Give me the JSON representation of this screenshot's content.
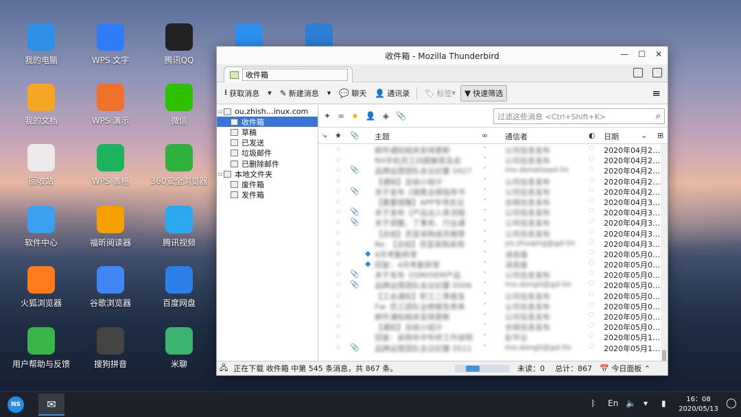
{
  "desktop": {
    "icons": [
      {
        "label": "我的电脑",
        "icon": "computer-icon",
        "color": "#2d8fe6"
      },
      {
        "label": "WPS 文字",
        "icon": "wps-writer-icon",
        "color": "#2f7cf6"
      },
      {
        "label": "腾讯QQ",
        "icon": "qq-icon",
        "color": "#222222"
      },
      {
        "label": "",
        "icon": "feather-app-icon",
        "color": "#2c8ff0"
      },
      {
        "label": "",
        "icon": "monitor-app-icon",
        "color": "#2b7fd6"
      },
      {
        "label": "我的文档",
        "icon": "folder-icon",
        "color": "#f5a623"
      },
      {
        "label": "WPS 演示",
        "icon": "wps-presentation-icon",
        "color": "#f0712c"
      },
      {
        "label": "微信",
        "icon": "wechat-icon",
        "color": "#2dc100"
      },
      {
        "label": "回收站",
        "icon": "recycle-bin-icon",
        "color": "#eaeaea"
      },
      {
        "label": "WPS 表格",
        "icon": "wps-spreadsheet-icon",
        "color": "#1bb35c"
      },
      {
        "label": "360安全浏览器",
        "icon": "browser-360-icon",
        "color": "#30b03c"
      },
      {
        "label": "软件中心",
        "icon": "software-center-icon",
        "color": "#3ca0f0"
      },
      {
        "label": "福昕阅读器",
        "icon": "foxit-reader-icon",
        "color": "#f5a000"
      },
      {
        "label": "腾讯视频",
        "icon": "tencent-video-icon",
        "color": "#2aa8f0"
      },
      {
        "label": "火狐浏览器",
        "icon": "firefox-icon",
        "color": "#ff7b1c"
      },
      {
        "label": "谷歌浏览器",
        "icon": "chrome-icon",
        "color": "#4285f4"
      },
      {
        "label": "百度网盘",
        "icon": "baidu-netdisk-icon",
        "color": "#2b7fe6"
      },
      {
        "label": "用户帮助与反馈",
        "icon": "help-feedback-icon",
        "color": "#3ab54a"
      },
      {
        "label": "搜狗拼音",
        "icon": "sogou-pinyin-icon",
        "color": "#444444"
      },
      {
        "label": "米聊",
        "icon": "miliao-icon",
        "color": "#3cb371"
      }
    ]
  },
  "window": {
    "title": "收件箱 - Mozilla Thunderbird",
    "tab_label": "收件箱"
  },
  "toolbar": {
    "get_mail": "获取消息",
    "write": "新建消息",
    "chat": "聊天",
    "address_book": "通讯录",
    "tag": "标签",
    "quick_filter": "快速筛选"
  },
  "folders": {
    "account": "ou.zhish…inux.com",
    "items": [
      {
        "label": "收件箱",
        "selected": true
      },
      {
        "label": "草稿",
        "selected": false
      },
      {
        "label": "已发送",
        "selected": false
      },
      {
        "label": "垃圾邮件",
        "selected": false
      },
      {
        "label": "已删除邮件",
        "selected": false
      }
    ],
    "local_label": "本地文件夹",
    "local_items": [
      {
        "label": "废件箱"
      },
      {
        "label": "发件箱"
      }
    ]
  },
  "quickfilter": {
    "placeholder": "过滤这些消息 <Ctrl+Shift+K>"
  },
  "columns": {
    "subject": "主题",
    "correspondent": "通信者",
    "date": "日期"
  },
  "messages": [
    {
      "subject": "邮件通知相关安排更新",
      "from": "公司信息发布",
      "date": "2020年04月2…",
      "att": false,
      "tag": false
    },
    {
      "subject": "RH手机员工问题解答及会",
      "from": "公司信息发布",
      "date": "2020年04月2…",
      "att": false,
      "tag": false
    },
    {
      "subject": "品牌运营团队会议纪要 0427",
      "from": "mo.donatioad-lin",
      "date": "2020年04月2…",
      "att": true,
      "tag": false
    },
    {
      "subject": "【通知】总结小组计",
      "from": "公司信息发布",
      "date": "2020年04月2…",
      "att": false,
      "tag": false
    },
    {
      "subject": "关于发布《销售业绩指导书",
      "from": "公司信息发布",
      "date": "2020年04月2…",
      "att": true,
      "tag": false
    },
    {
      "subject": "【重要提醒】APP专项会议",
      "from": "合规信息发布",
      "date": "2020年04月3…",
      "att": false,
      "tag": false
    },
    {
      "subject": "关于发布《产品出入库流程",
      "from": "公司信息发布",
      "date": "2020年04月3…",
      "att": true,
      "tag": false
    },
    {
      "subject": "关于调整、丁事务、行业通",
      "from": "公司信息发布",
      "date": "2020年04月3…",
      "att": true,
      "tag": false
    },
    {
      "subject": "【总结】员宣采购成员推荐",
      "from": "公司信息发布",
      "date": "2020年04月3…",
      "att": false,
      "tag": false
    },
    {
      "subject": "Re: 【总结】员宣采购采用",
      "from": "yo.zhuqing@gd-lin",
      "date": "2020年04月3…",
      "att": false,
      "tag": false
    },
    {
      "subject": "4月考勤异常",
      "from": "消息版",
      "date": "2020年05月0…",
      "att": false,
      "tag": true
    },
    {
      "subject": "回复：4月考勤异常",
      "from": "消息版",
      "date": "2020年05月0…",
      "att": false,
      "tag": true
    },
    {
      "subject": "关于发布《ISM/OEM产品",
      "from": "公司信息发布",
      "date": "2020年05月0…",
      "att": true,
      "tag": false
    },
    {
      "subject": "品牌运营团队会议纪要 0506",
      "from": "mo.dongli@gd-lin",
      "date": "2020年05月0…",
      "att": true,
      "tag": false
    },
    {
      "subject": "【工会通知】职工二季度发",
      "from": "公司信息发布",
      "date": "2020年05月0…",
      "att": false,
      "tag": false
    },
    {
      "subject": "Fw: 员工团队业绩报告表单",
      "from": "公司信息发布",
      "date": "2020年05月0…",
      "att": false,
      "tag": false
    },
    {
      "subject": "邮件通知相关安排更新",
      "from": "公司信息发布",
      "date": "2020年05月0…",
      "att": false,
      "tag": false
    },
    {
      "subject": "【通知】总结小组计",
      "from": "合规信息发布",
      "date": "2020年05月0…",
      "att": false,
      "tag": false
    },
    {
      "subject": "回复：采购年中年终工作说明",
      "from": "彭华云",
      "date": "2020年05月1…",
      "att": false,
      "tag": false
    },
    {
      "subject": "品牌运营团队会议纪要 0511",
      "from": "mo.dongli@gd-lin",
      "date": "2020年05月1…",
      "att": true,
      "tag": false
    }
  ],
  "status": {
    "text": "正在下载 收件箱 中第 545 条消息，共 867 条。",
    "progress": 0.45,
    "unread_label": "未读：",
    "unread": "0",
    "total_label": "总计：",
    "total": "867",
    "today_pane": "今日面板"
  },
  "taskbar": {
    "start_label": "NS",
    "ime": "En",
    "time": "16：08",
    "date": "2020/05/13"
  }
}
